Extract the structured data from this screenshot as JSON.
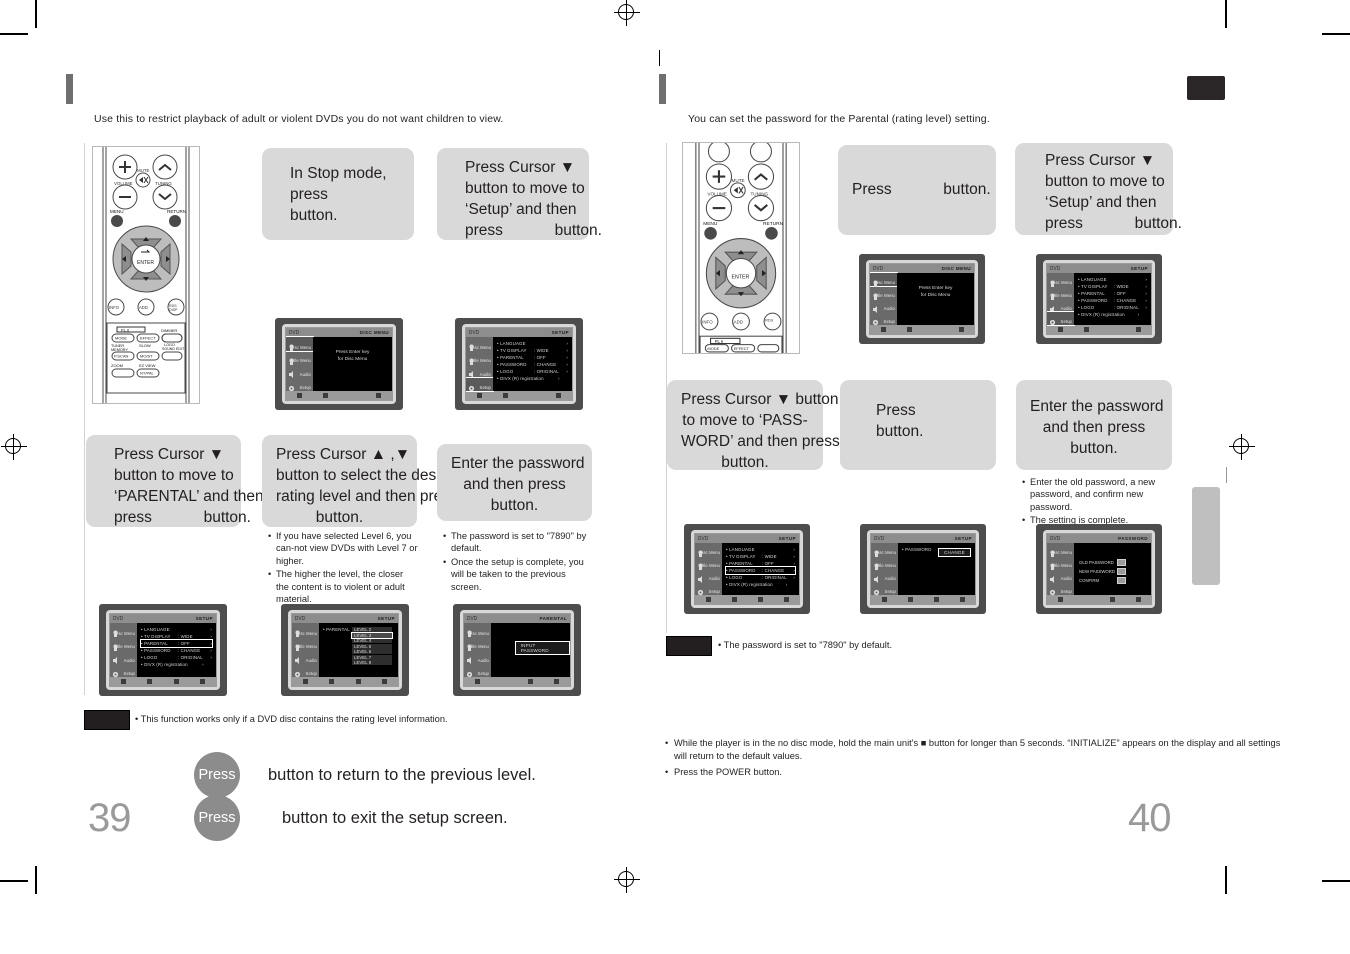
{
  "document": {
    "left_page_number": "39",
    "right_page_number": "40"
  },
  "left_page": {
    "intro": "Use this to restrict playback of adult or violent DVDs you do not want children to view.",
    "steps": [
      {
        "id": "step1",
        "lines": [
          "In Stop mode,",
          "press",
          "button."
        ],
        "align": "left"
      },
      {
        "id": "step2",
        "lines": [
          "Press Cursor ▼",
          "button to move to",
          "‘Setup’ and then",
          "press            button."
        ],
        "align": "left"
      },
      {
        "id": "step3",
        "lines": [
          "Press Cursor ▼",
          "button to move to",
          "‘PARENTAL’ and then",
          "press            button."
        ],
        "align": "left"
      },
      {
        "id": "step4",
        "lines": [
          "Press Cursor ▲ ,▼",
          "button to select the desired",
          "rating level and then press",
          "button."
        ],
        "align": "center"
      },
      {
        "id": "step5",
        "lines": [
          "Enter the password",
          "and then press",
          "button."
        ],
        "align": "center"
      }
    ],
    "notes_step4": [
      "If you have selected Level 6, you can-not view DVDs with Level 7 or higher.",
      "The higher the level, the closer the content is to violent or adult material."
    ],
    "notes_step5": [
      "The password is set to \"7890\" by default.",
      "Once the setup is complete, you will be taken to the previous screen."
    ],
    "note_chip_text": "This function works only if a DVD disc contains the rating level information.",
    "press_rows": [
      {
        "circle": "Press",
        "text": "button to return to the previous level."
      },
      {
        "circle": "Press",
        "text": "button to exit the setup screen."
      }
    ],
    "screens": [
      {
        "id": "disc-menu-screen",
        "header_left": "DVD",
        "header_right": "DISC MENU",
        "side_items": [
          "Disc Menu",
          "Title Menu",
          "Audio",
          "Setup"
        ],
        "selected_side": "Disc Menu",
        "center_message": [
          "Press Enter key",
          "for Disc Menu"
        ]
      },
      {
        "id": "setup-screen",
        "header_left": "DVD",
        "header_right": "SETUP",
        "side_items": [
          "Disc Menu",
          "Title Menu",
          "Audio",
          "Setup"
        ],
        "selected_side": "Setup",
        "rows": [
          {
            "name": "LANGUAGE",
            "value": ""
          },
          {
            "name": "TV  DISPLAY",
            "value": ": WIDE"
          },
          {
            "name": "PARENTAL",
            "value": ": OFF"
          },
          {
            "name": "PASSWORD",
            "value": ": CHANGE"
          },
          {
            "name": "LOGO",
            "value": ": ORIGINAL"
          },
          {
            "name": "DIVX (R) registration",
            "value": ""
          }
        ],
        "selected_row": ""
      },
      {
        "id": "setup-parental-highlight-screen",
        "header_left": "DVD",
        "header_right": "SETUP",
        "side_items": [
          "Disc Menu",
          "Title Menu",
          "Audio",
          "Setup"
        ],
        "selected_side": "",
        "rows": [
          {
            "name": "LANGUAGE",
            "value": ""
          },
          {
            "name": "TV  DISPLAY",
            "value": ": WIDE"
          },
          {
            "name": "PARENTAL",
            "value": ": OFF"
          },
          {
            "name": "PASSWORD",
            "value": ": CHANGE"
          },
          {
            "name": "LOGO",
            "value": ": ORIGINAL"
          },
          {
            "name": "DIVX (R) registration",
            "value": ""
          }
        ],
        "selected_row": "PARENTAL"
      },
      {
        "id": "parental-level-list-screen",
        "header_left": "DVD",
        "header_right": "SETUP",
        "side_items": [
          "Disc Menu",
          "Title Menu",
          "Audio",
          "Setup"
        ],
        "selected_side": "",
        "rows": [
          {
            "name": "PARENTAL",
            "value": ""
          }
        ],
        "levels": [
          "LEVEL 2",
          "LEVEL 3",
          "LEVEL 4",
          "LEVEL 5",
          "LEVEL 6",
          "LEVEL 7",
          "LEVEL 8"
        ],
        "selected_level": "LEVEL 3"
      },
      {
        "id": "input-password-screen",
        "header_left": "DVD",
        "header_right": "PARENTAL",
        "side_items": [
          "Disc Menu",
          "Title Menu",
          "Audio",
          "Setup"
        ],
        "selected_side": "",
        "password_box": "INPUT PASSWORD"
      }
    ]
  },
  "right_page": {
    "intro": "You can set the password for the Parental (rating level) setting.",
    "steps": [
      {
        "id": "rstep1",
        "lines": [
          "Press            button."
        ],
        "align": "center"
      },
      {
        "id": "rstep2",
        "lines": [
          "Press Cursor ▼",
          "button to move to",
          "‘Setup’ and then",
          "press            button."
        ],
        "align": "left"
      },
      {
        "id": "rstep3",
        "lines": [
          "Press Cursor ▼ button",
          "to move to ‘PASS-",
          "WORD’ and then press",
          "button."
        ],
        "align": "center"
      },
      {
        "id": "rstep4",
        "lines": [
          "Press",
          "button."
        ],
        "align": "left"
      },
      {
        "id": "rstep5",
        "lines": [
          "Enter the password",
          "and then press",
          "button."
        ],
        "align": "center"
      }
    ],
    "notes_step5": [
      "Enter the old password, a new password, and confirm new password.",
      "The setting is complete."
    ],
    "note_chip_text": "The password is set to \"7890\" by default.",
    "footnotes": [
      "While the player is in the no disc mode, hold the main unit's ■ button for longer than 5 seconds. “INITIALIZE” appears on the display and all settings will return to the default values.",
      "Press the POWER button."
    ],
    "screens": [
      {
        "id": "r-disc-menu-screen",
        "header_left": "DVD",
        "header_right": "DISC MENU",
        "side_items": [
          "Disc Menu",
          "Title Menu",
          "Audio",
          "Setup"
        ],
        "selected_side": "Disc Menu",
        "center_message": [
          "Press Enter key",
          "for Disc Menu"
        ]
      },
      {
        "id": "r-setup-screen",
        "header_left": "DVD",
        "header_right": "SETUP",
        "side_items": [
          "Disc Menu",
          "Title Menu",
          "Audio",
          "Setup"
        ],
        "selected_side": "Setup",
        "rows": [
          {
            "name": "LANGUAGE",
            "value": ""
          },
          {
            "name": "TV  DISPLAY",
            "value": ": WIDE"
          },
          {
            "name": "PARENTAL",
            "value": ": OFF"
          },
          {
            "name": "PASSWORD",
            "value": ": CHANGE"
          },
          {
            "name": "LOGO",
            "value": ": ORIGINAL"
          },
          {
            "name": "DIVX (R) registration",
            "value": ""
          }
        ],
        "selected_row": ""
      },
      {
        "id": "r-setup-password-highlight-screen",
        "header_left": "DVD",
        "header_right": "SETUP",
        "side_items": [
          "Disc Menu",
          "Title Menu",
          "Audio",
          "Setup"
        ],
        "selected_side": "",
        "rows": [
          {
            "name": "LANGUAGE",
            "value": ""
          },
          {
            "name": "TV  DISPLAY",
            "value": ": WIDE"
          },
          {
            "name": "PARENTAL",
            "value": ": OFF"
          },
          {
            "name": "PASSWORD",
            "value": ": CHANGE"
          },
          {
            "name": "LOGO",
            "value": ": ORIGINAL"
          },
          {
            "name": "DIVX (R) registration",
            "value": ""
          }
        ],
        "selected_row": "PASSWORD"
      },
      {
        "id": "r-password-change-screen",
        "header_left": "DVD",
        "header_right": "SETUP",
        "side_items": [
          "Disc Menu",
          "Title Menu",
          "Audio",
          "Setup"
        ],
        "selected_side": "",
        "rows": [
          {
            "name": "PASSWORD",
            "value": ""
          }
        ],
        "change_box": "CHANGE"
      },
      {
        "id": "r-password-entry-screen",
        "header_left": "DVD",
        "header_right": "PASSWORD",
        "side_items": [
          "Disc Menu",
          "Title Menu",
          "Audio",
          "Setup"
        ],
        "selected_side": "",
        "fields": [
          "OLD PASSWORD",
          "NEW PASSWORD",
          "CONFIRM"
        ]
      }
    ]
  },
  "remote": {
    "labels": {
      "volume": "VOLUME",
      "mute": "MUTE",
      "tuning": "TUNING",
      "menu": "MENU",
      "return": "RETURN",
      "enter": "ENTER",
      "info": "INFO",
      "mode": "MODE",
      "dimmer": "DIMMER",
      "test_tone": "TEST TONE",
      "logo": "LOGO",
      "sound_edit": "SOUND EDIT",
      "p_scan": "P.SCAN",
      "mo_st": "MO/ST",
      "zoom": "ZOOM",
      "nt_pal": "NT/PAL",
      "effect": "EFFECT",
      "dsp_eq": "DSP/EQ",
      "slow": "SLOW",
      "tuner_memory": "TUNERMEMORY",
      "ez_view": "EZ VIEW"
    }
  },
  "colors": {
    "bubble_bg": "#d9d9d9",
    "text": "#231f20",
    "page_number": "#9a9a9a",
    "chip": "#231f20",
    "side_tab": "#bfbfbf",
    "section_bar": "#6f6f6f"
  }
}
